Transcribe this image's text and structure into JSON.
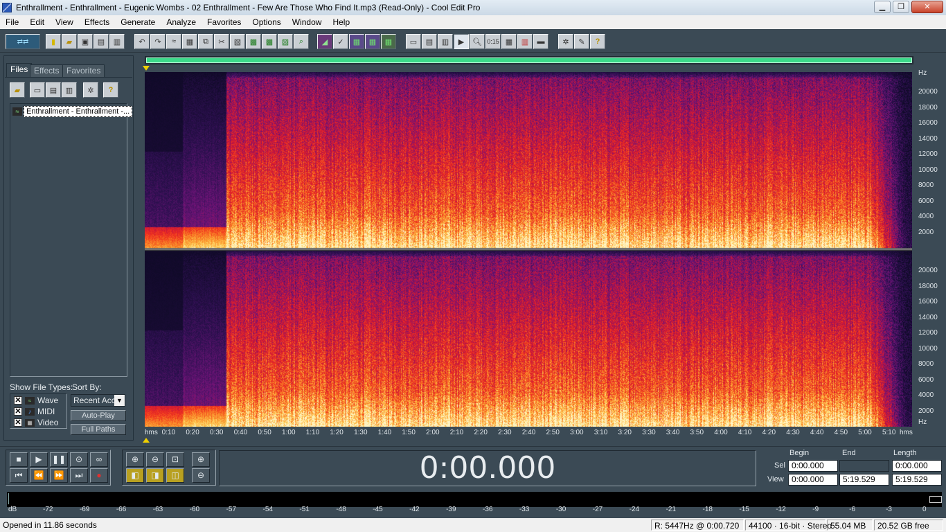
{
  "window": {
    "title": "Enthrallment - Enthrallment - Eugenic Wombs - 02 Enthrallment - Few Are Those Who Find It.mp3 (Read-Only) - Cool Edit Pro"
  },
  "menu": [
    "File",
    "Edit",
    "View",
    "Effects",
    "Generate",
    "Analyze",
    "Favorites",
    "Options",
    "Window",
    "Help"
  ],
  "organizer": {
    "tabs": [
      "Files",
      "Effects",
      "Favorites"
    ],
    "active_tab": "Files",
    "files": [
      "Enthrallment - Enthrallment -..."
    ],
    "show_file_types_label": "Show File Types:",
    "sort_by_label": "Sort By:",
    "sort_value": "Recent Acc",
    "types": [
      {
        "label": "Wave",
        "checked": true,
        "icon": "wave-icon"
      },
      {
        "label": "MIDI",
        "checked": true,
        "icon": "midi-icon"
      },
      {
        "label": "Video",
        "checked": true,
        "icon": "video-icon"
      }
    ],
    "auto_play_label": "Auto-Play",
    "full_paths_label": "Full Paths"
  },
  "spectrogram": {
    "hz_unit": "Hz",
    "hz_ticks": [
      "20000",
      "18000",
      "16000",
      "14000",
      "12000",
      "10000",
      "8000",
      "6000",
      "4000",
      "2000"
    ],
    "time_unit": "hms",
    "time_ticks": [
      "0:10",
      "0:20",
      "0:30",
      "0:40",
      "0:50",
      "1:00",
      "1:10",
      "1:20",
      "1:30",
      "1:40",
      "1:50",
      "2:00",
      "2:10",
      "2:20",
      "2:30",
      "2:40",
      "2:50",
      "3:00",
      "3:10",
      "3:20",
      "3:30",
      "3:40",
      "3:50",
      "4:00",
      "4:10",
      "4:20",
      "4:30",
      "4:40",
      "4:50",
      "5:00",
      "5:10"
    ],
    "duration_seconds": 319.529
  },
  "transport": {
    "time": "0:00.000",
    "begin_label": "Begin",
    "end_label": "End",
    "length_label": "Length",
    "sel_label": "Sel",
    "view_label": "View",
    "sel_begin": "0:00.000",
    "sel_end": "",
    "sel_length": "0:00.000",
    "view_begin": "0:00.000",
    "view_end": "5:19.529",
    "view_length": "5:19.529"
  },
  "meter": {
    "unit": "dB",
    "ticks": [
      "-72",
      "-69",
      "-66",
      "-63",
      "-60",
      "-57",
      "-54",
      "-51",
      "-48",
      "-45",
      "-42",
      "-39",
      "-36",
      "-33",
      "-30",
      "-27",
      "-24",
      "-21",
      "-18",
      "-15",
      "-12",
      "-9",
      "-6",
      "-3",
      "0"
    ]
  },
  "status": {
    "message": "Opened in 11.86 seconds",
    "cursor": "R: 5447Hz @   0:00.720",
    "format": "44100 · 16-bit · Stereo",
    "size": "55.04 MB",
    "free": "20.52 GB free"
  }
}
